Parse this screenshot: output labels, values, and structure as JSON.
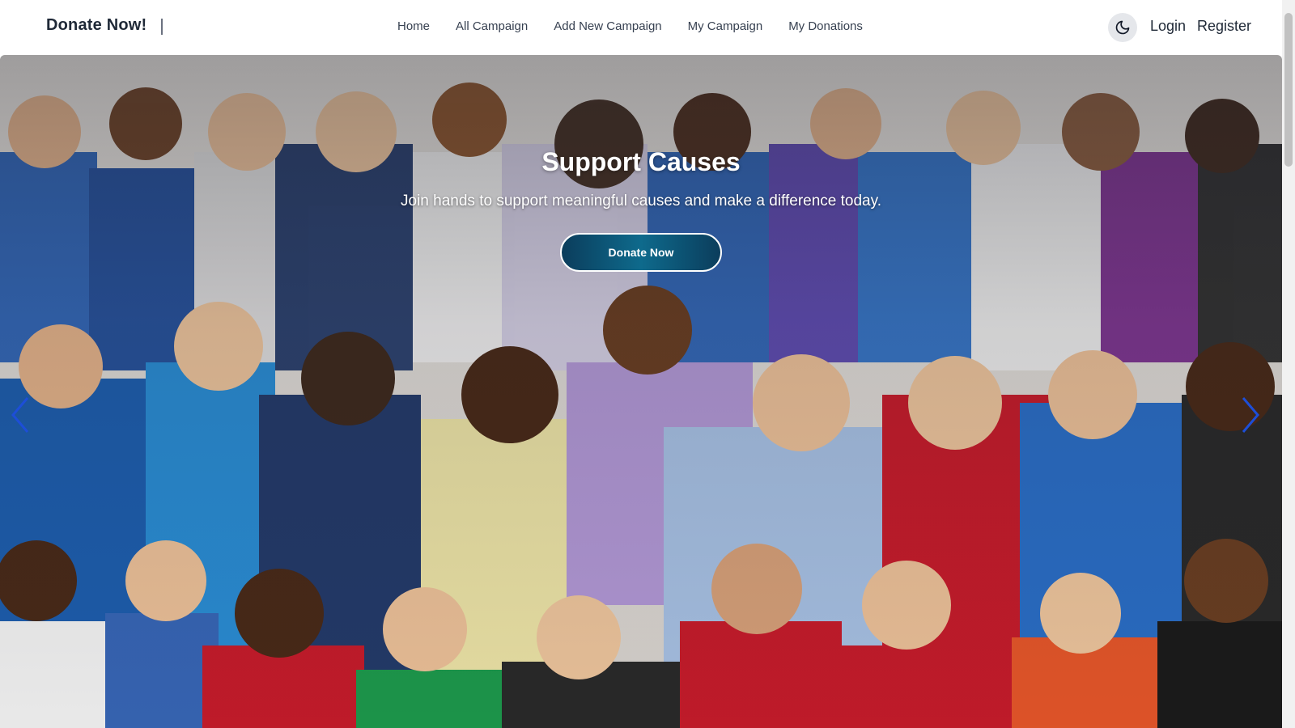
{
  "navbar": {
    "brand": "Donate Now!",
    "links": [
      "Home",
      "All Campaign",
      "Add New Campaign",
      "My Campaign",
      "My Donations"
    ],
    "theme_toggle_icon": "moon-icon",
    "login": "Login",
    "register": "Register"
  },
  "hero": {
    "title": "Support Causes",
    "subtitle": "Join hands to support meaningful causes and make a difference today.",
    "cta": "Donate Now",
    "prev_icon": "chevron-left-icon",
    "next_icon": "chevron-right-icon",
    "accent_color": "#0e6a8c",
    "arrow_color": "#1d4ed8"
  }
}
